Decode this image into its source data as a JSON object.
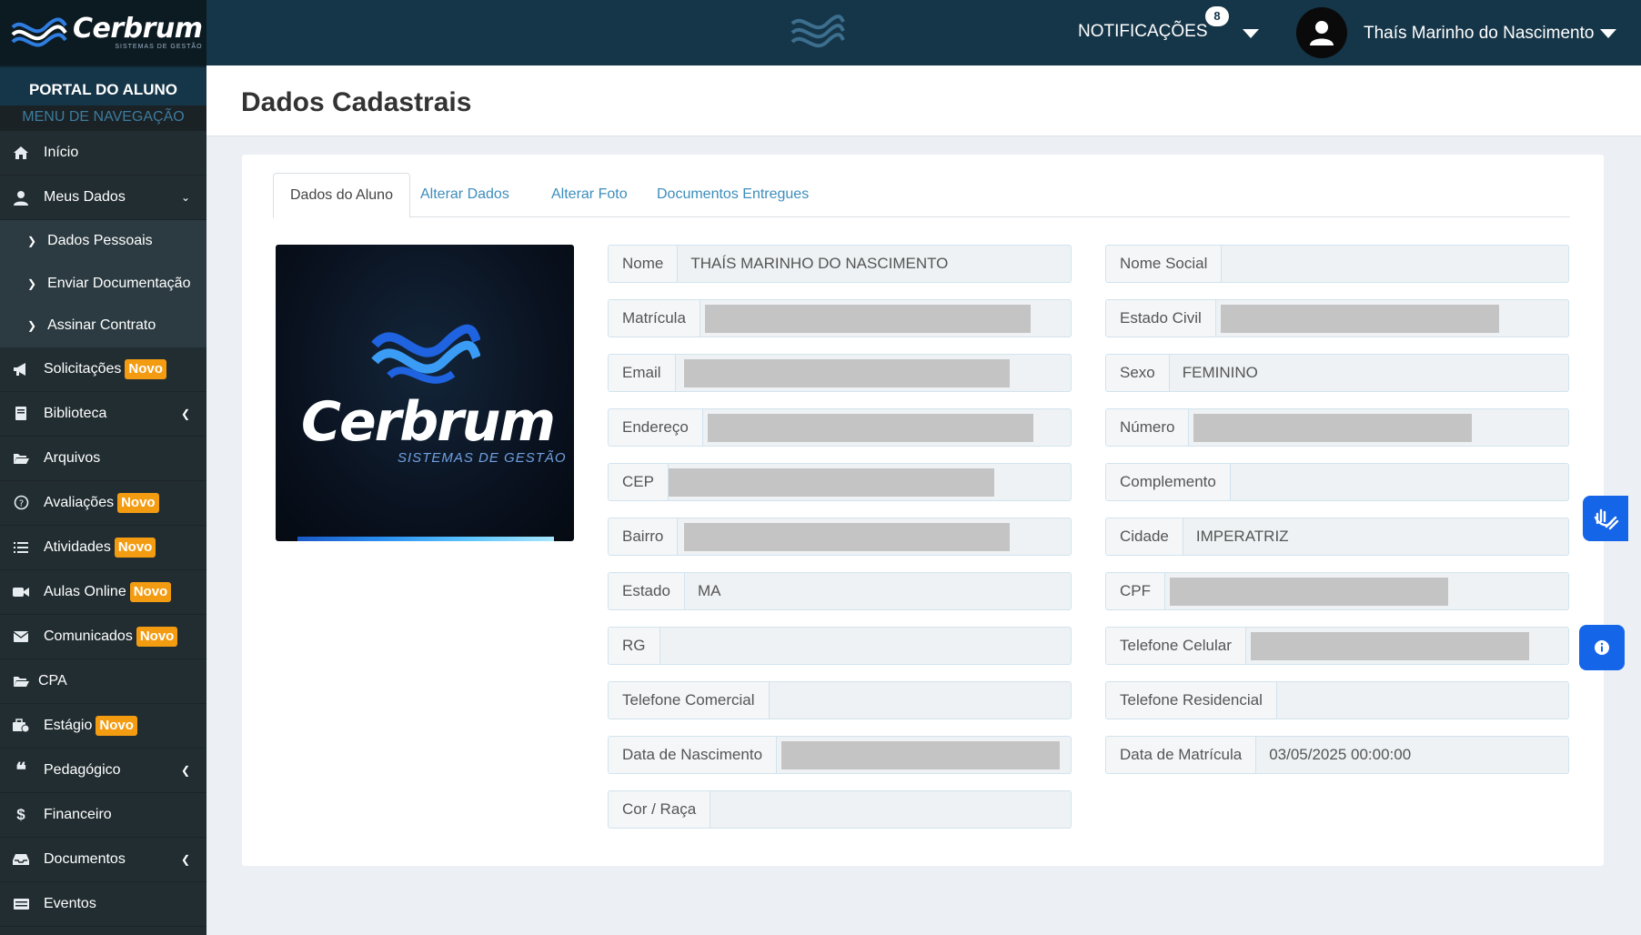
{
  "brand": {
    "name": "Cerbrum",
    "tagline": "SISTEMAS DE GESTÃO"
  },
  "sidebar": {
    "portal_title": "PORTAL DO ALUNO",
    "menu_header": "MENU DE NAVEGAÇÃO",
    "items": [
      {
        "label": "Início",
        "icon": "home-icon"
      },
      {
        "label": "Meus Dados",
        "icon": "user-icon",
        "chevron": "down"
      },
      {
        "label": "Dados Pessoais",
        "sub": true
      },
      {
        "label": "Enviar Documentação",
        "sub": true
      },
      {
        "label": "Assinar Contrato",
        "sub": true
      },
      {
        "label": "Solicitações",
        "icon": "megaphone-icon",
        "badge": "Novo"
      },
      {
        "label": "Biblioteca",
        "icon": "book-icon",
        "chevron": "left"
      },
      {
        "label": "Arquivos",
        "icon": "folder-open-icon"
      },
      {
        "label": "Avaliações",
        "icon": "question-circle-icon",
        "badge": "Novo"
      },
      {
        "label": "Atividades",
        "icon": "list-icon",
        "badge": "Novo"
      },
      {
        "label": "Aulas Online",
        "icon": "video-camera-icon",
        "badge": "Novo"
      },
      {
        "label": "Comunicados",
        "icon": "envelope-icon",
        "badge": "Novo"
      },
      {
        "label": "CPA",
        "icon": "folder-open-icon"
      },
      {
        "label": "Estágio",
        "icon": "briefcase-icon",
        "badge": "Novo"
      },
      {
        "label": "Pedagógico",
        "icon": "quote-icon",
        "chevron": "left"
      },
      {
        "label": "Financeiro",
        "icon": "dollar-icon"
      },
      {
        "label": "Documentos",
        "icon": "inbox-icon",
        "chevron": "left"
      },
      {
        "label": "Eventos",
        "icon": "calendar-icon"
      }
    ]
  },
  "topbar": {
    "notifications_label": "NOTIFICAÇÕES",
    "notifications_count": "8",
    "user_name": "Thaís Marinho do Nascimento"
  },
  "page": {
    "title": "Dados Cadastrais"
  },
  "tabs": [
    "Dados do Aluno",
    "Alterar Dados",
    "Alterar Foto",
    "Documentos Entregues"
  ],
  "fields_left": [
    {
      "label": "Nome",
      "value": "THAÍS MARINHO DO NASCIMENTO"
    },
    {
      "label": "Matrícula",
      "value": ""
    },
    {
      "label": "Email",
      "value": ""
    },
    {
      "label": "Endereço",
      "value": ""
    },
    {
      "label": "CEP",
      "value": ""
    },
    {
      "label": "Bairro",
      "value": ""
    },
    {
      "label": "Estado",
      "value": "MA"
    },
    {
      "label": "RG",
      "value": ""
    },
    {
      "label": "Telefone Comercial",
      "value": ""
    },
    {
      "label": "Data de Nascimento",
      "value": ""
    },
    {
      "label": "Cor / Raça",
      "value": ""
    }
  ],
  "fields_right": [
    {
      "label": "Nome Social",
      "value": ""
    },
    {
      "label": "Estado Civil",
      "value": ""
    },
    {
      "label": "Sexo",
      "value": "FEMININO"
    },
    {
      "label": "Número",
      "value": ""
    },
    {
      "label": "Complemento",
      "value": ""
    },
    {
      "label": "Cidade",
      "value": "IMPERATRIZ"
    },
    {
      "label": "CPF",
      "value": ""
    },
    {
      "label": "Telefone Celular",
      "value": ""
    },
    {
      "label": "Telefone Residencial",
      "value": ""
    },
    {
      "label": "Data de Matrícula",
      "value": "03/05/2025 00:00:00"
    }
  ],
  "colors": {
    "sidebar": "#222d32",
    "topbar": "#153548",
    "accent": "#3c8dbc",
    "badge": "#f39c12",
    "float_button": "#1565e8"
  }
}
